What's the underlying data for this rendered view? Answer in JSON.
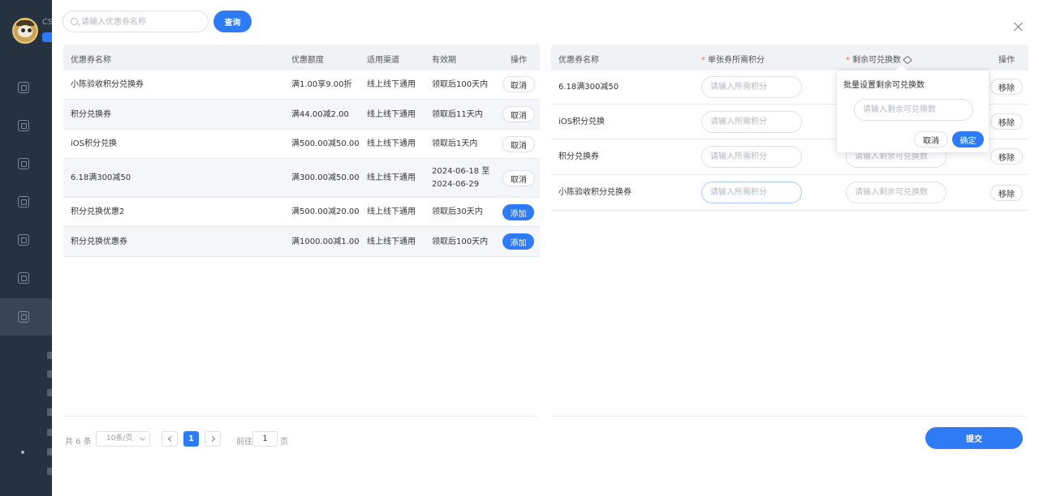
{
  "sidebar": {
    "brand": "CS"
  },
  "search": {
    "placeholder": "请输入优惠券名称",
    "query_label": "查询"
  },
  "left_table": {
    "headers": {
      "name": "优惠券名称",
      "amount": "优惠额度",
      "channel": "适用渠道",
      "validity": "有效期",
      "action": "操作"
    },
    "rows": [
      {
        "name": "小陈验收积分兑换券",
        "amount": "满1.00享9.00折",
        "channel": "线上线下通用",
        "validity": "领取后100天内",
        "validity2": "",
        "action": "取消"
      },
      {
        "name": "积分兑换券",
        "amount": "满44.00减2.00",
        "channel": "线上线下通用",
        "validity": "领取后11天内",
        "validity2": "",
        "action": "取消"
      },
      {
        "name": "iOS积分兑换",
        "amount": "满500.00减50.00",
        "channel": "线上线下通用",
        "validity": "领取后1天内",
        "validity2": "",
        "action": "取消"
      },
      {
        "name": "6.18满300减50",
        "amount": "满300.00减50.00",
        "channel": "线上线下通用",
        "validity": "2024-06-18 至",
        "validity2": "2024-06-29",
        "action": "取消"
      },
      {
        "name": "积分兑换优惠2",
        "amount": "满500.00减20.00",
        "channel": "线上线下通用",
        "validity": "领取后30天内",
        "validity2": "",
        "action": "添加"
      },
      {
        "name": "积分兑换优惠券",
        "amount": "满1000.00减1.00",
        "channel": "线上线下通用",
        "validity": "领取后100天内",
        "validity2": "",
        "action": "添加"
      }
    ]
  },
  "right_table": {
    "headers": {
      "name": "优惠券名称",
      "required_points": "单张券所需积分",
      "remaining": "剩余可兑换数",
      "action": "操作"
    },
    "required_mark": "*",
    "points_placeholder": "请输入所需积分",
    "remaining_placeholder": "请输入剩余可兑换数",
    "remove_label": "移除",
    "rows": [
      {
        "name": "6.18满300减50"
      },
      {
        "name": "iOS积分兑换"
      },
      {
        "name": "积分兑换券"
      },
      {
        "name": "小陈验收积分兑换券"
      }
    ]
  },
  "popover": {
    "title": "批量设置剩余可兑换数",
    "placeholder": "请输入剩余可兑换数",
    "cancel_label": "取消",
    "confirm_label": "确定"
  },
  "pagination": {
    "total": "共 6 条",
    "page_size": "10条/页",
    "current_page": "1",
    "goto_prefix": "前往",
    "goto_value": "1",
    "goto_suffix": "页"
  },
  "submit_label": "提交",
  "colors": {
    "primary": "#2f7bf5",
    "sidebar": "#273240",
    "required": "#f56c6c"
  }
}
